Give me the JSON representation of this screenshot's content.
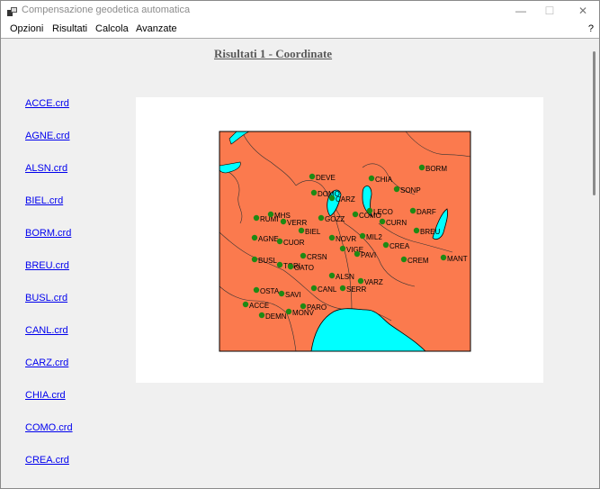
{
  "window": {
    "title": "Compensazione geodetica automatica",
    "minimize": "—",
    "maximize": "☐",
    "close": "✕"
  },
  "menu": {
    "items": [
      "Opzioni",
      "Risultati",
      "Calcola",
      "Avanzate"
    ],
    "help": "?"
  },
  "heading": "Risultati 1 - Coordinate",
  "files": [
    "ACCE.crd",
    "AGNE.crd",
    "ALSN.crd",
    "BIEL.crd",
    "BORM.crd",
    "BREU.crd",
    "BUSL.crd",
    "CANL.crd",
    "CARZ.crd",
    "CHIA.crd",
    "COMO.crd",
    "CREA.crd"
  ],
  "colors": {
    "land": "#fb7a4e",
    "water": "#00ffff",
    "station": "#1e8a14",
    "link": "#0000ee"
  },
  "map": {
    "stations": [
      "DEVE",
      "CHIA",
      "BORM",
      "SONP",
      "DOMO",
      "CARZ",
      "DARF",
      "RUMI",
      "MHS",
      "VERR",
      "GOZZ",
      "COMO",
      "LECO",
      "CURN",
      "BREU",
      "AGNE",
      "CUOR",
      "BIEL",
      "NOVR",
      "MIL2",
      "CREA",
      "VIGE",
      "PAVI",
      "MANT",
      "CRSN",
      "CREM",
      "BUSL",
      "TORI",
      "OATO",
      "ALSN",
      "VARZ",
      "SERR",
      "OSTA",
      "SAVI",
      "CANL",
      "ACCE",
      "PARO",
      "DEMN",
      "MONV"
    ]
  }
}
